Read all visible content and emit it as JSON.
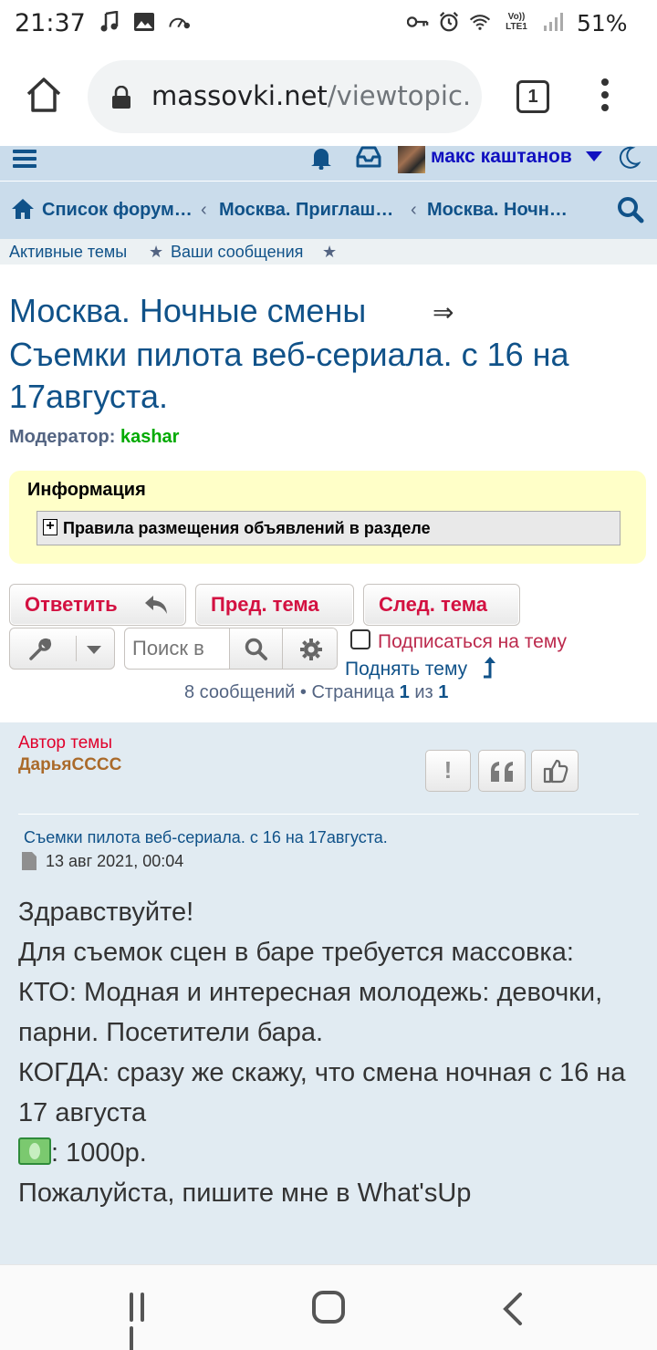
{
  "status_bar": {
    "time": "21:37",
    "battery": "51%",
    "lte_line1": "Vo))",
    "lte_line2": "LTE1",
    "icons_left": [
      "music-note-icon",
      "image-icon",
      "speedometer-icon"
    ],
    "icons_right": [
      "key-icon",
      "alarm-icon",
      "wifi-icon",
      "lte-icon",
      "signal-icon"
    ]
  },
  "browser": {
    "url_domain": "massovki.net",
    "url_path": "/viewtopic.",
    "tab_count": "1"
  },
  "header": {
    "username": "макс каштанов",
    "icons": [
      "menu-icon",
      "bell-icon",
      "inbox-icon",
      "avatar",
      "moon-icon"
    ]
  },
  "breadcrumbs": {
    "items": [
      "Список форум…",
      "Москва. Приглаш…",
      "Москва. Ночн…"
    ],
    "separator": "‹"
  },
  "quicklinks": {
    "active": "Активные темы",
    "mine": "Ваши сообщения",
    "star": "★"
  },
  "topic": {
    "forum": "Москва. Ночные смены",
    "arrow": "⇒",
    "title": "Съемки пилота веб-сериала. с 16 на 17августа.",
    "moderator_label": "Модератор:",
    "moderator_name": "kashar"
  },
  "info": {
    "title": "Информация",
    "spoiler_plus": "+",
    "spoiler_label": "Правила размещения объявлений в разделе"
  },
  "actions": {
    "reply": "Ответить",
    "prev": "Пред. тема",
    "next": "След. тема",
    "search_placeholder": "Поиск в",
    "subscribe": "Подписаться на тему",
    "bump": "Поднять тему",
    "pagination_prefix": "8 сообщений • Страница",
    "page_current": "1",
    "page_of": "из",
    "page_total": "1"
  },
  "post": {
    "author_label": "Автор темы",
    "author_name": "ДарьяСССС",
    "report": "!",
    "subject": "Съемки пилота веб-сериала. с 16 на 17августа.",
    "date": "13 авг 2021, 00:04",
    "lines": [
      "Здравствуйте!",
      "Для съемок сцен в баре требуется массовка:",
      "КТО: Модная и интересная молодежь: девочки, парни. Посетители бара.",
      "КОГДА: сразу же скажу, что смена ночная с 16 на 17 августа",
      ": 1000р.",
      "Пожалуйста, пишите мне в What'sUp"
    ]
  },
  "colors": {
    "link": "#105289",
    "header_bg": "#cadceb",
    "post_bg": "#e1ebf2",
    "button_text": "#d31141",
    "info_bg": "#ffffc8"
  }
}
